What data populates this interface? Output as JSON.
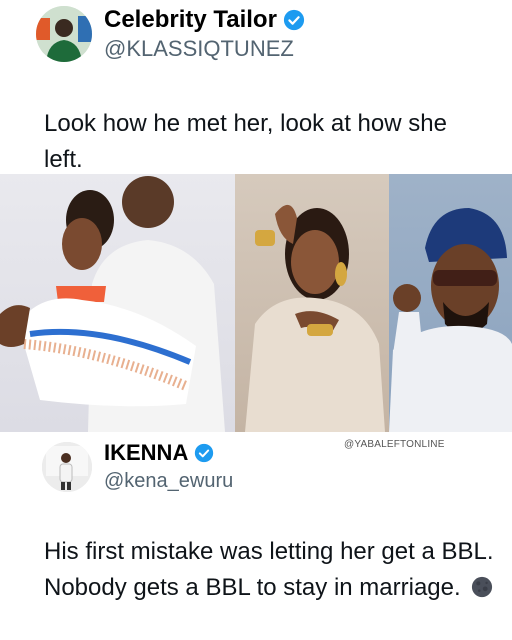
{
  "top_tweet": {
    "display_name": "Celebrity Tailor",
    "handle": "@KLASSIQTUNEZ",
    "text": "Look how he met her, look at how she left."
  },
  "images": {
    "watermark": "@YABALEFTONLINE"
  },
  "bottom_tweet": {
    "display_name": "IKENNA",
    "handle": "@kena_ewuru",
    "text": "His first mistake was letting her get a BBL. Nobody gets a BBL to stay in marriage.",
    "emoji_icon": "new-moon-face-icon"
  },
  "colors": {
    "verified_blue": "#1d9bf0",
    "handle_gray": "#536471",
    "text_black": "#0f1419"
  }
}
